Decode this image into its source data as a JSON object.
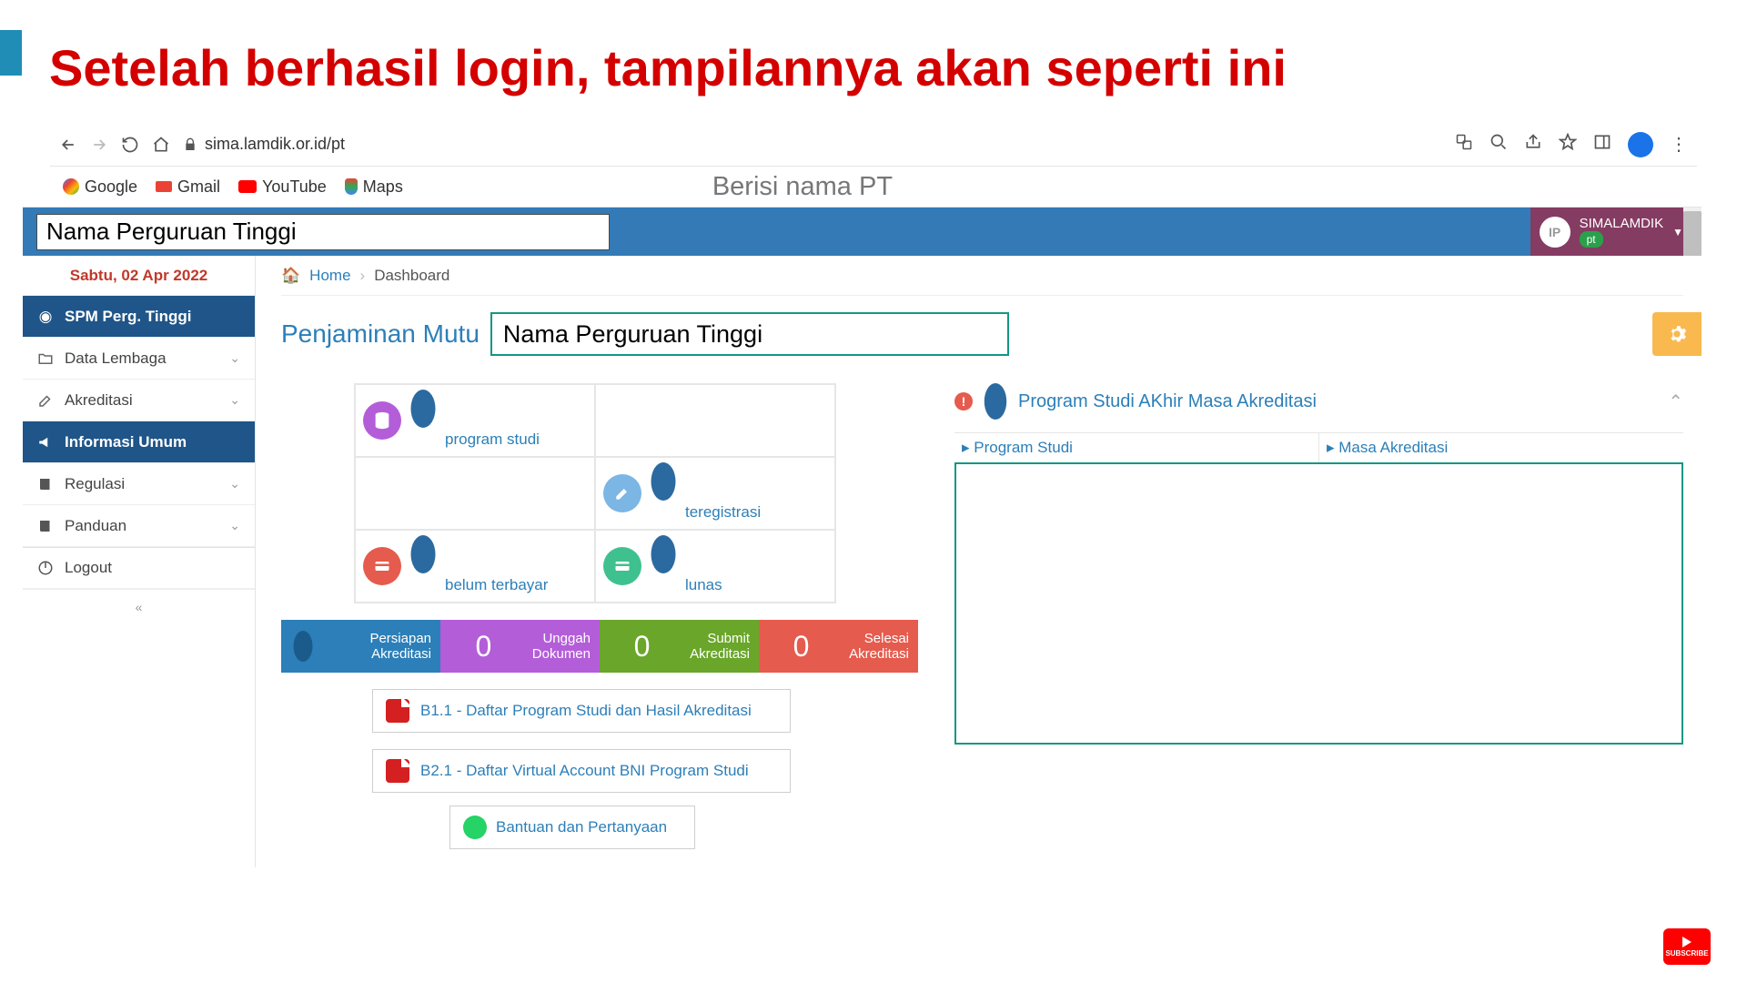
{
  "slide_heading": "Setelah berhasil login, tampilannya akan seperti ini",
  "annotation": "Berisi nama PT",
  "browser": {
    "url": "sima.lamdik.or.id/pt",
    "bookmarks": {
      "google": "Google",
      "gmail": "Gmail",
      "youtube": "YouTube",
      "maps": "Maps"
    }
  },
  "app": {
    "pt_name": "Nama Perguruan Tinggi",
    "user": {
      "initials": "IP",
      "name": "SIMALAMDIK",
      "role": "pt"
    },
    "date": "Sabtu, 02 Apr 2022",
    "sidebar": [
      {
        "icon": "dashboard-icon",
        "label": "SPM Perg. Tinggi",
        "variant": "primary",
        "expand": false
      },
      {
        "icon": "folder-icon",
        "label": "Data Lembaga",
        "variant": "plain",
        "expand": true
      },
      {
        "icon": "edit-icon",
        "label": "Akreditasi",
        "variant": "plain",
        "expand": true
      },
      {
        "icon": "megaphone-icon",
        "label": "Informasi Umum",
        "variant": "primary",
        "expand": false
      },
      {
        "icon": "book-icon",
        "label": "Regulasi",
        "variant": "plain",
        "expand": true
      },
      {
        "icon": "book-icon",
        "label": "Panduan",
        "variant": "plain",
        "expand": true
      },
      {
        "icon": "power-icon",
        "label": "Logout",
        "variant": "plain",
        "expand": false
      }
    ],
    "breadcrumb": {
      "home": "Home",
      "current": "Dashboard"
    },
    "page_title_prefix": "Penjaminan Mutu",
    "page_title_box": "Nama Perguruan Tinggi",
    "stats": {
      "program_studi": "program studi",
      "teregistrasi": "teregistrasi",
      "belum_terbayar": "belum terbayar",
      "lunas": "lunas"
    },
    "status": [
      {
        "count": "",
        "l1": "Persiapan",
        "l2": "Akreditasi",
        "color": "sblue"
      },
      {
        "count": "0",
        "l1": "Unggah",
        "l2": "Dokumen",
        "color": "spurple"
      },
      {
        "count": "0",
        "l1": "Submit",
        "l2": "Akreditasi",
        "color": "sgreen"
      },
      {
        "count": "0",
        "l1": "Selesai",
        "l2": "Akreditasi",
        "color": "sred"
      }
    ],
    "docs": {
      "b11": "B1.1 - Daftar Program Studi dan Hasil Akreditasi",
      "b21": "B2.1 - Daftar Virtual Account BNI Program Studi",
      "wa": "Bantuan dan Pertanyaan"
    },
    "right_panel": {
      "title": "Program Studi AKhir Masa Akreditasi",
      "col1": "Program Studi",
      "col2": "Masa Akreditasi"
    }
  },
  "yt_subscribe": "SUBSCRIBE"
}
